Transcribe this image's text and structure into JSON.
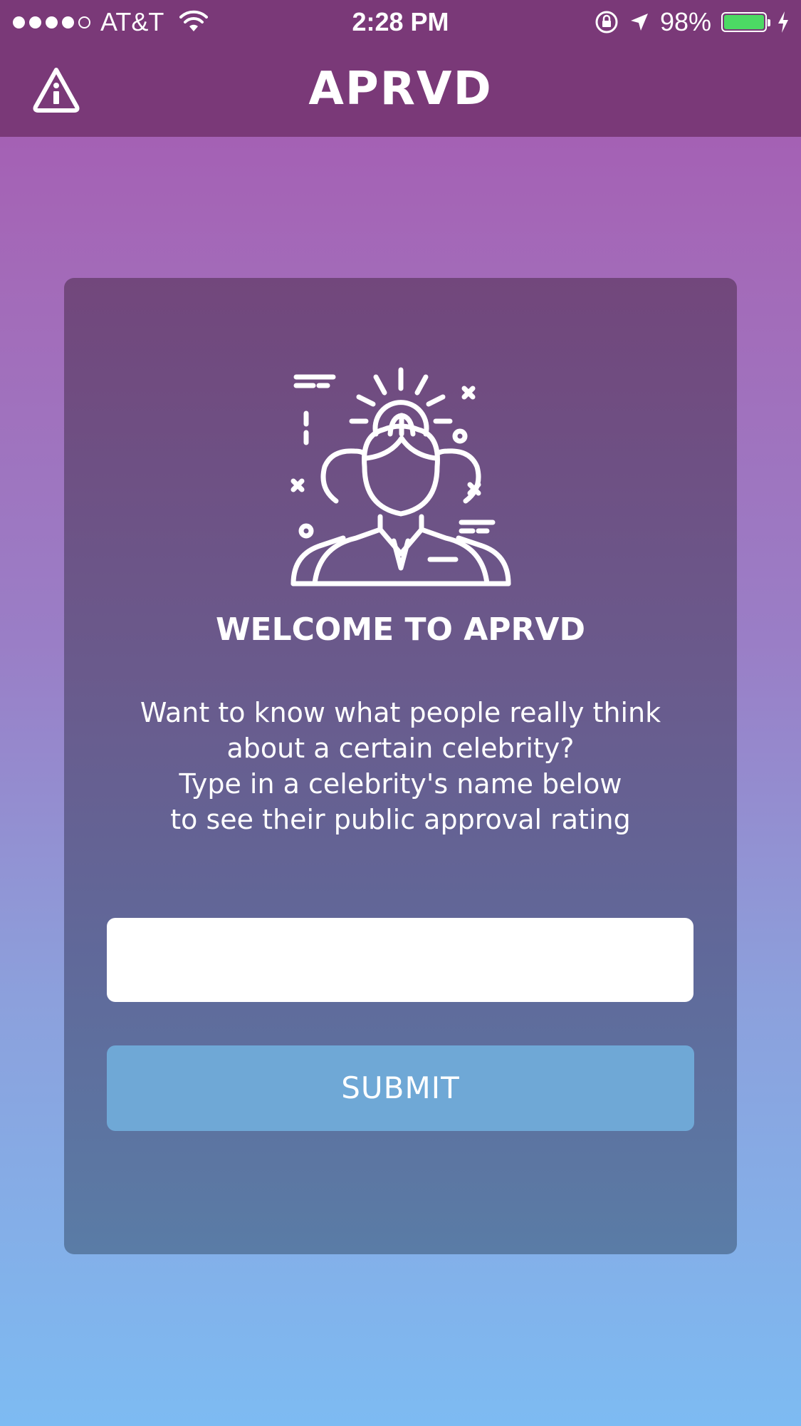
{
  "status_bar": {
    "carrier": "AT&T",
    "time": "2:28 PM",
    "battery_percent": "98%",
    "battery_level": 0.98,
    "signal_bars_filled": 4,
    "signal_bars_total": 5
  },
  "nav": {
    "title": "APRVD",
    "left_icon": "info-warning-icon"
  },
  "card": {
    "illustration_icon": "people-idea-brain-icon",
    "title": "WELCOME TO APRVD",
    "description_lines": [
      "Want to know what people really think",
      "about a certain celebrity?",
      "Type in a celebrity's name below",
      "to see their public approval rating"
    ],
    "input": {
      "value": "",
      "placeholder": ""
    },
    "submit_label": "SUBMIT"
  },
  "colors": {
    "nav_bar": "#7a3978",
    "card_top": "#72477c",
    "card_bottom": "#5a7ca6",
    "submit_button": "#6fa8d6",
    "battery_fill": "#4cd964"
  }
}
